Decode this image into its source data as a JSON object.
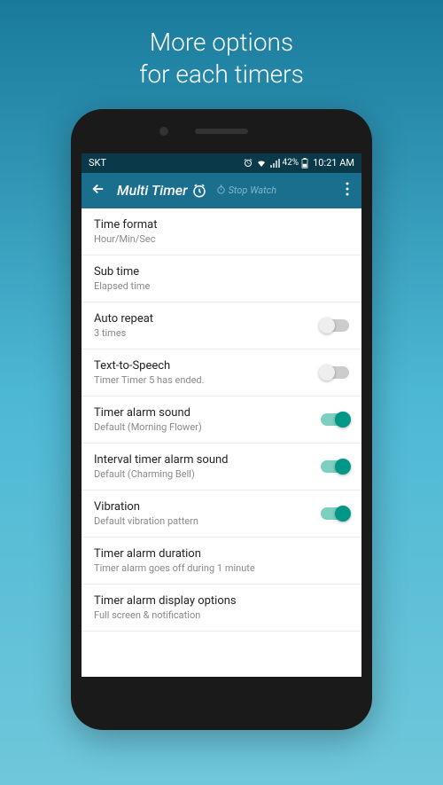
{
  "promo": {
    "line1": "More options",
    "line2": "for each timers"
  },
  "statusbar": {
    "carrier": "SKT",
    "battery": "42%",
    "time": "10:21 AM"
  },
  "appbar": {
    "title": "Multi Timer",
    "stopwatch": "Stop Watch"
  },
  "settings": [
    {
      "title": "Time format",
      "subtitle": "Hour/Min/Sec",
      "toggle": null
    },
    {
      "title": "Sub time",
      "subtitle": "Elapsed time",
      "toggle": null
    },
    {
      "title": "Auto repeat",
      "subtitle": "3 times",
      "toggle": false
    },
    {
      "title": "Text-to-Speech",
      "subtitle": "Timer Timer 5 has ended.",
      "toggle": false
    },
    {
      "title": "Timer alarm sound",
      "subtitle": "Default (Morning Flower)",
      "toggle": true
    },
    {
      "title": "Interval timer alarm sound",
      "subtitle": "Default (Charming Bell)",
      "toggle": true
    },
    {
      "title": "Vibration",
      "subtitle": "Default vibration pattern",
      "toggle": true
    },
    {
      "title": "Timer alarm duration",
      "subtitle": "Timer alarm goes off during 1 minute",
      "toggle": null
    },
    {
      "title": "Timer alarm display options",
      "subtitle": "Full screen & notification",
      "toggle": null
    }
  ]
}
